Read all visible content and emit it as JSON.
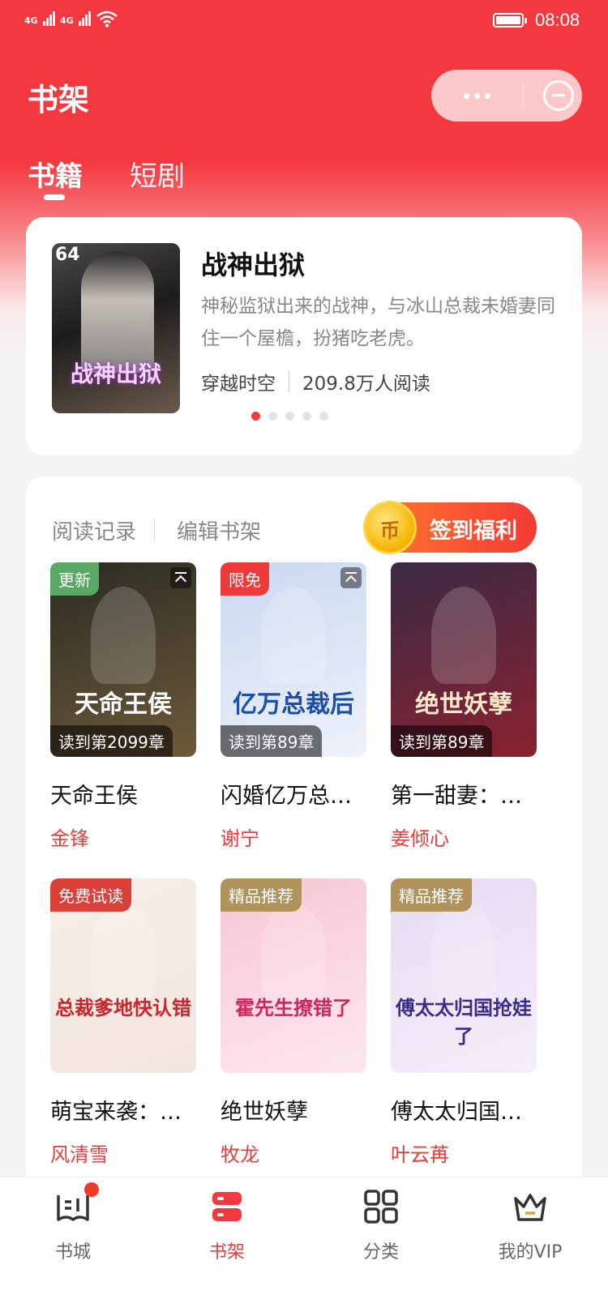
{
  "status_bar": {
    "signal1": "4G",
    "signal2": "4G",
    "time": "08:08"
  },
  "header": {
    "title": "书架",
    "capsule_icons": [
      "more-icon",
      "close-circle-icon"
    ],
    "tabs": [
      {
        "label": "书籍",
        "active": true
      },
      {
        "label": "短剧",
        "active": false
      }
    ]
  },
  "featured": {
    "cover_number": "64",
    "cover_art_text": "战神出狱",
    "title": "战神出狱",
    "description": "神秘监狱出来的战神，与冰山总裁未婚妻同住一个屋檐，扮猪吃老虎。",
    "category": "穿越时空",
    "readers": "209.8万人阅读",
    "carousel_total": 5,
    "carousel_active": 1
  },
  "shelf": {
    "reading_history": "阅读记录",
    "edit_shelf": "编辑书架",
    "signin_label": "签到福利",
    "signin_icon": "coin-icon",
    "books": [
      {
        "name": "天命王侯",
        "author": "金锋",
        "badge": "更新",
        "badge_color": "#5aa865",
        "progress": "读到第2099章",
        "pinned": true,
        "art": "天命王侯",
        "cover_colors": [
          "#2b2b24",
          "#6e5a3a"
        ]
      },
      {
        "name": "闪婚亿万总…",
        "author": "谢宁",
        "badge": "限免",
        "badge_color": "#ee3a3a",
        "progress": "读到第89章",
        "pinned": true,
        "art": "亿万总裁后",
        "cover_colors": [
          "#c9d8f0",
          "#eef2fb"
        ]
      },
      {
        "name": "第一甜妻：…",
        "author": "姜倾心",
        "badge": "",
        "badge_color": "",
        "progress": "读到第89章",
        "pinned": false,
        "art": "绝世妖孽",
        "cover_colors": [
          "#3a2a44",
          "#8a2230"
        ]
      },
      {
        "name": "萌宝来袭：…",
        "author": "风清雪",
        "badge": "免费试读",
        "badge_color": "#d9413a",
        "progress": "",
        "pinned": false,
        "art": "总裁爹地快认错",
        "cover_colors": [
          "#f6efe8",
          "#f3e4e0"
        ]
      },
      {
        "name": "绝世妖孽",
        "author": "牧龙",
        "badge": "精品推荐",
        "badge_color": "#b0925d",
        "progress": "",
        "pinned": false,
        "art": "霍先生撩错了",
        "cover_colors": [
          "#f7c6d3",
          "#fde7ee"
        ]
      },
      {
        "name": "傅太太归国…",
        "author": "叶云苒",
        "badge": "精品推荐",
        "badge_color": "#b0925d",
        "progress": "",
        "pinned": false,
        "art": "傅太太归国抢娃了",
        "cover_colors": [
          "#e6dbf3",
          "#f5eefa"
        ]
      }
    ]
  },
  "bottom_nav": [
    {
      "label": "书城",
      "icon": "bookstore-icon",
      "active": false,
      "dot": true
    },
    {
      "label": "书架",
      "icon": "bookshelf-icon",
      "active": true,
      "dot": false
    },
    {
      "label": "分类",
      "icon": "category-grid-icon",
      "active": false,
      "dot": false
    },
    {
      "label": "我的VIP",
      "icon": "vip-crown-icon",
      "active": false,
      "dot": false
    }
  ],
  "colors": {
    "brand_red": "#f3383f",
    "author_red": "#ef3b3b"
  }
}
